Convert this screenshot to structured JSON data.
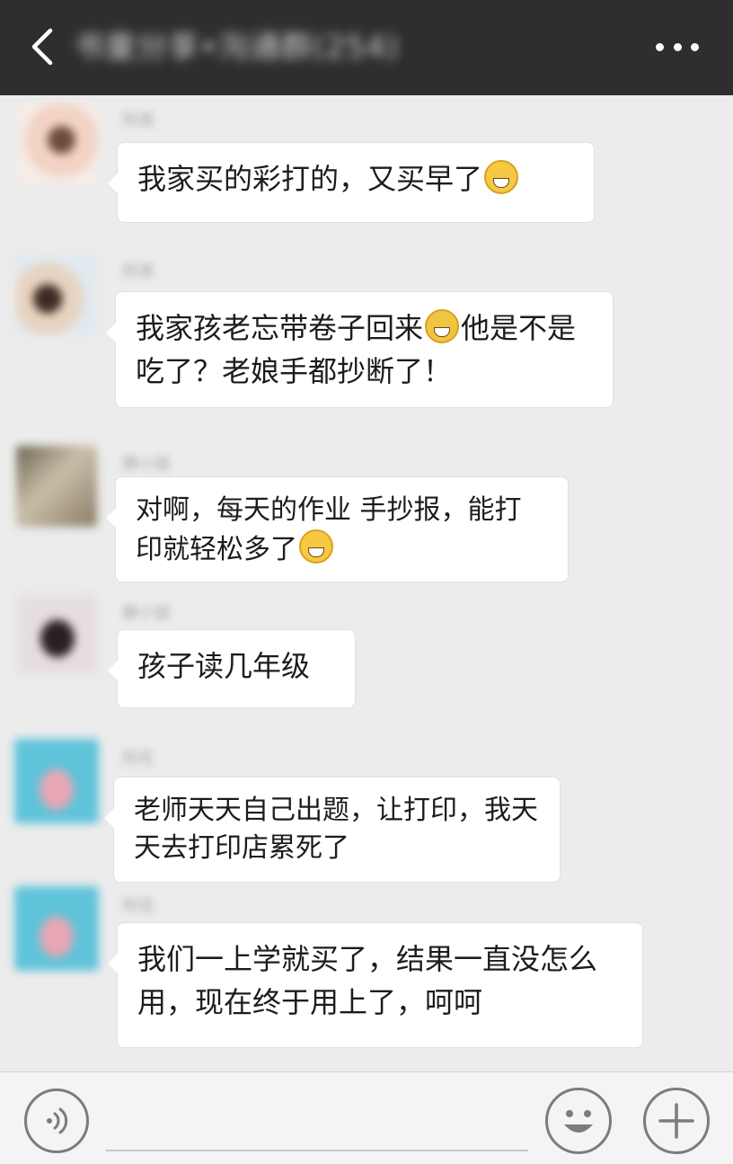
{
  "header": {
    "title": "书童分享•沟通群(254)"
  },
  "messages": [
    {
      "sender": "阿英",
      "text_before": "我家买的彩打的，又买早了",
      "has_emoji": true,
      "emoji": "grin-emoji",
      "text_after": ""
    },
    {
      "sender": "阿英",
      "text_before": "我家孩老忘带卷子回来",
      "has_emoji": true,
      "emoji": "cry-emoji",
      "text_after": "他是不是吃了？老娘手都抄断了！"
    },
    {
      "sender": "静小姐",
      "text_before": "对啊，每天的作业 手抄报，能打印就轻松多了",
      "has_emoji": true,
      "emoji": "think-emoji",
      "text_after": ""
    },
    {
      "sender": "静小姐",
      "text_before": "孩子读几年级",
      "has_emoji": false,
      "text_after": ""
    },
    {
      "sender": "阿花",
      "text_before": "老师天天自己出题，让打印，我天天去打印店累死了",
      "has_emoji": false,
      "text_after": ""
    },
    {
      "sender": "阿花",
      "text_before": "我们一上学就买了，结果一直没怎么用，现在终于用上了，呵呵",
      "has_emoji": false,
      "text_after": ""
    }
  ],
  "colors": {
    "topbar": "#2e2e30",
    "background": "#ececec",
    "bubble": "#ffffff"
  },
  "input": {
    "placeholder": ""
  }
}
